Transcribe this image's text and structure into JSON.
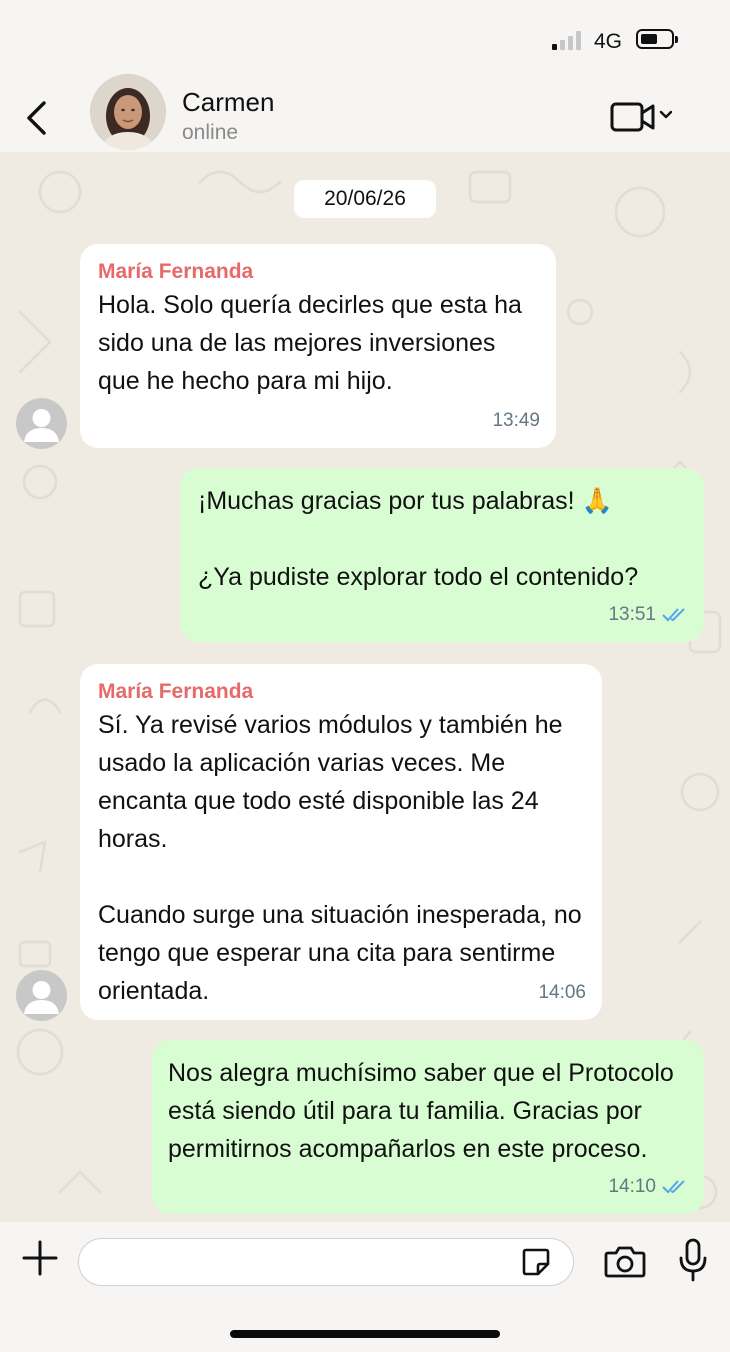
{
  "status_bar": {
    "network": "4G"
  },
  "header": {
    "name": "Carmen",
    "status": "online"
  },
  "chat": {
    "date": "20/06/26",
    "messages": [
      {
        "direction": "in",
        "sender": "María Fernanda",
        "text": "Hola. Solo quería decirles que esta ha sido una de las mejores inversiones que he hecho para mi hijo.",
        "time": "13:49"
      },
      {
        "direction": "out",
        "text": "¡Muchas gracias por tus palabras! 🙏\n\n¿Ya pudiste explorar todo el contenido?",
        "time": "13:51",
        "status": "read"
      },
      {
        "direction": "in",
        "sender": "María Fernanda",
        "text": "Sí. Ya revisé varios módulos y también he usado la aplicación varias veces. Me encanta que todo esté disponible las 24 horas.\n\nCuando surge una situación inesperada, no tengo que esperar una cita para sentirme orientada.",
        "time": "14:06"
      },
      {
        "direction": "out",
        "text": "Nos alegra muchísimo saber que el Protocolo está siendo útil para tu familia. Gracias por permitirnos acompañarlos en este proceso.",
        "time": "14:10",
        "status": "read"
      }
    ]
  },
  "input": {
    "placeholder": ""
  },
  "colors": {
    "sender": "#e76a6a",
    "outgoing_bubble": "#d9fdd3",
    "read_ticks": "#53a6ec"
  },
  "icons": [
    "back-arrow-icon",
    "video-call-icon",
    "chevron-down-icon",
    "plus-icon",
    "sticker-icon",
    "camera-icon",
    "microphone-icon",
    "double-check-icon"
  ]
}
